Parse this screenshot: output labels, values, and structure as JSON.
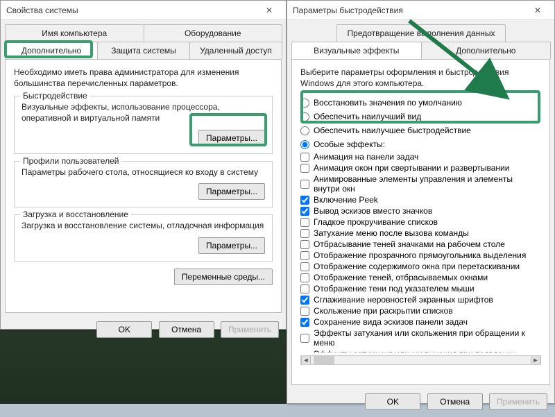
{
  "win1": {
    "title": "Свойства системы",
    "tabs_row1": [
      "Имя компьютера",
      "Оборудование"
    ],
    "tabs_row2": [
      "Дополнительно",
      "Защита системы",
      "Удаленный доступ"
    ],
    "active_tab": "Дополнительно",
    "desc": "Необходимо иметь права администратора для изменения большинства перечисленных параметров.",
    "group_perf": {
      "legend": "Быстродействие",
      "desc": "Визуальные эффекты, использование процессора, оперативной и виртуальной памяти",
      "btn": "Параметры..."
    },
    "group_prof": {
      "legend": "Профили пользователей",
      "desc": "Параметры рабочего стола, относящиеся ко входу в систему",
      "btn": "Параметры..."
    },
    "group_boot": {
      "legend": "Загрузка и восстановление",
      "desc": "Загрузка и восстановление системы, отладочная информация",
      "btn": "Параметры..."
    },
    "env_btn": "Переменные среды...",
    "ok": "OK",
    "cancel": "Отмена",
    "apply": "Применить"
  },
  "win2": {
    "title": "Параметры быстродействия",
    "tab_group_top": "Предотвращение выполнения данных",
    "tabs": [
      "Визуальные эффекты",
      "Дополнительно"
    ],
    "active_tab": "Визуальные эффекты",
    "desc": "Выберите параметры оформления и быстродействия Windows для этого компьютера.",
    "radios": [
      {
        "label": "Восстановить значения по умолчанию",
        "checked": false
      },
      {
        "label": "Обеспечить наилучший вид",
        "checked": false
      },
      {
        "label": "Обеспечить наилучшее быстродействие",
        "checked": false
      },
      {
        "label": "Особые эффекты:",
        "checked": true
      }
    ],
    "checks": [
      {
        "label": "Анимация на панели задач",
        "checked": false
      },
      {
        "label": "Анимация окон при свертывании и развертывании",
        "checked": false
      },
      {
        "label": "Анимированные элементы управления и элементы внутри окн",
        "checked": false
      },
      {
        "label": "Включение Peek",
        "checked": true
      },
      {
        "label": "Вывод эскизов вместо значков",
        "checked": true
      },
      {
        "label": "Гладкое прокручивание списков",
        "checked": false
      },
      {
        "label": "Затухание меню после вызова команды",
        "checked": false
      },
      {
        "label": "Отбрасывание теней значками на рабочем столе",
        "checked": false
      },
      {
        "label": "Отображение прозрачного прямоугольника выделения",
        "checked": false
      },
      {
        "label": "Отображение содержимого окна при перетаскивании",
        "checked": false
      },
      {
        "label": "Отображение теней, отбрасываемых окнами",
        "checked": false
      },
      {
        "label": "Отображение тени под указателем мыши",
        "checked": false
      },
      {
        "label": "Сглаживание неровностей экранных шрифтов",
        "checked": true
      },
      {
        "label": "Скольжение при раскрытии списков",
        "checked": false
      },
      {
        "label": "Сохранение вида эскизов панели задач",
        "checked": true
      },
      {
        "label": "Эффекты затухания или скольжения при обращении к меню",
        "checked": false
      },
      {
        "label": "Эффекты затухания или скольжения при появлении подсказок",
        "checked": false
      }
    ],
    "ok": "OK",
    "cancel": "Отмена",
    "apply": "Применить"
  }
}
